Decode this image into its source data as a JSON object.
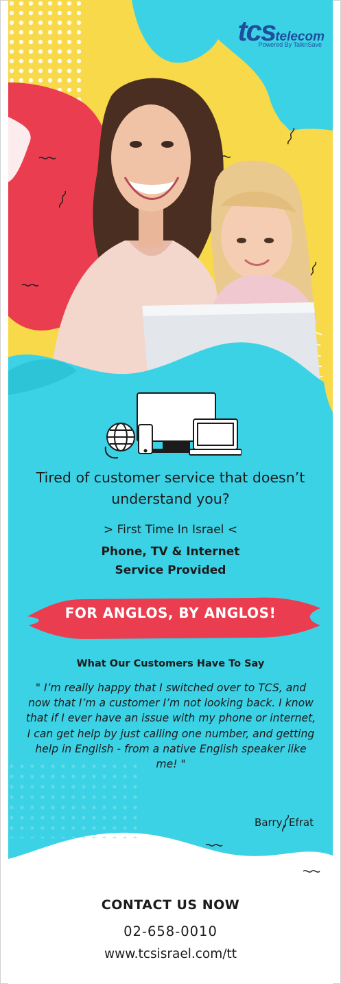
{
  "brand": {
    "logo_main": "tcs",
    "logo_sub": "telecom",
    "logo_tagline": "Powered By TalknSave",
    "accent_blue": "#1e4f9c"
  },
  "hero": {
    "image": "woman-and-girl-with-laptop",
    "colors": {
      "cyan": "#3cd2e6",
      "yellow": "#f8d94a",
      "red": "#ea3d4f"
    }
  },
  "devices_icon": "devices-icon",
  "tagline": "Tired of customer service that doesn’t understand you?",
  "subline": "> First Time In Israel <",
  "service_line1": "Phone, TV & Internet",
  "service_line2": "Service Provided",
  "slogan": "FOR ANGLOS, BY ANGLOS!",
  "testimonials": {
    "title": "What Our Customers Have To Say",
    "quote": "\" I’m really happy that I switched over to TCS, and now that I’m a customer I’m not looking back. I know that if I ever have an issue with my phone or internet, I can get help by just calling one number, and getting help in English - from a native English speaker like me! \"",
    "author": "Barry, Efrat"
  },
  "contact": {
    "heading": "CONTACT US NOW",
    "phone": "02-658-0010",
    "website": "www.tcsisrael.com/tt"
  }
}
